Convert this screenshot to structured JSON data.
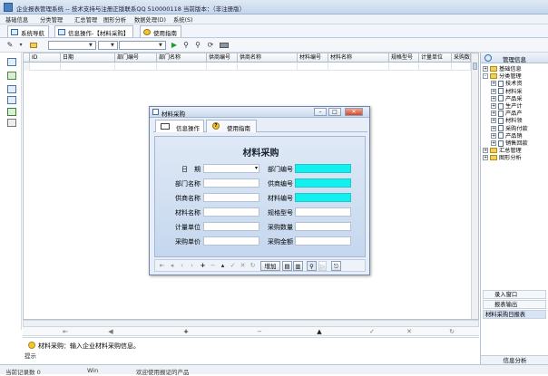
{
  "window": {
    "title": "企业报表管理系统 -- 技术支持与注册正版联系QQ 510000118  当前版本：（非注册版）"
  },
  "menu": [
    "基础信息",
    "分类管理",
    "汇总管理",
    "图形分析",
    "数据处理(D)",
    "系统(S)"
  ],
  "tabs": [
    {
      "label": "系统导航"
    },
    {
      "label": "信息操作-【材料采购】"
    },
    {
      "label": "使用指南"
    }
  ],
  "grid": {
    "columns": [
      "ID",
      "日期",
      "部门编号",
      "部门名称",
      "供商编号",
      "供商名称",
      "材料编号",
      "材料名称",
      "规格型号",
      "计量单位",
      "采购数"
    ]
  },
  "hint": {
    "text": "材料采购：输入企业材料采购信息。",
    "caption": "提示"
  },
  "status": [
    "当前记录数 0",
    "Win",
    "欢迎使用报证的产品"
  ],
  "right_panel": {
    "title": "管理信息",
    "tree": [
      {
        "label": "基础信息",
        "level": 0,
        "kind": "folder",
        "sign": "+"
      },
      {
        "label": "分类管理",
        "level": 0,
        "kind": "folder",
        "sign": "-"
      },
      {
        "label": "技术资",
        "level": 1,
        "kind": "doc",
        "sign": "+"
      },
      {
        "label": "材料采",
        "level": 1,
        "kind": "doc",
        "sign": "+"
      },
      {
        "label": "产品采",
        "level": 1,
        "kind": "doc",
        "sign": "+"
      },
      {
        "label": "生产计",
        "level": 1,
        "kind": "doc",
        "sign": "+"
      },
      {
        "label": "产品产",
        "level": 1,
        "kind": "doc",
        "sign": "+"
      },
      {
        "label": "材料领",
        "level": 1,
        "kind": "doc",
        "sign": "+"
      },
      {
        "label": "采购付款",
        "level": 1,
        "kind": "doc",
        "sign": "+"
      },
      {
        "label": "产品销",
        "level": 1,
        "kind": "doc",
        "sign": "+"
      },
      {
        "label": "销售回款",
        "level": 1,
        "kind": "doc",
        "sign": "+"
      },
      {
        "label": "汇总管理",
        "level": 0,
        "kind": "folder",
        "sign": "+"
      },
      {
        "label": "图形分析",
        "level": 0,
        "kind": "folder",
        "sign": "+"
      }
    ],
    "bottom_buttons": [
      "录入窗口",
      "报表输出",
      "材料采购日报表"
    ],
    "footer": "信息分析"
  },
  "dialog": {
    "title": "材料采购",
    "tabs": [
      "信息操作",
      "使用指南"
    ],
    "heading": "材料采购",
    "fields": {
      "left": [
        "日　期",
        "部门名称",
        "供商名称",
        "材料名称",
        "计量单位",
        "采购单价"
      ],
      "right": [
        "部门编号",
        "供商编号",
        "材料编号",
        "规格型号",
        "采购数量",
        "采购金额"
      ]
    },
    "add_button": "增加"
  }
}
